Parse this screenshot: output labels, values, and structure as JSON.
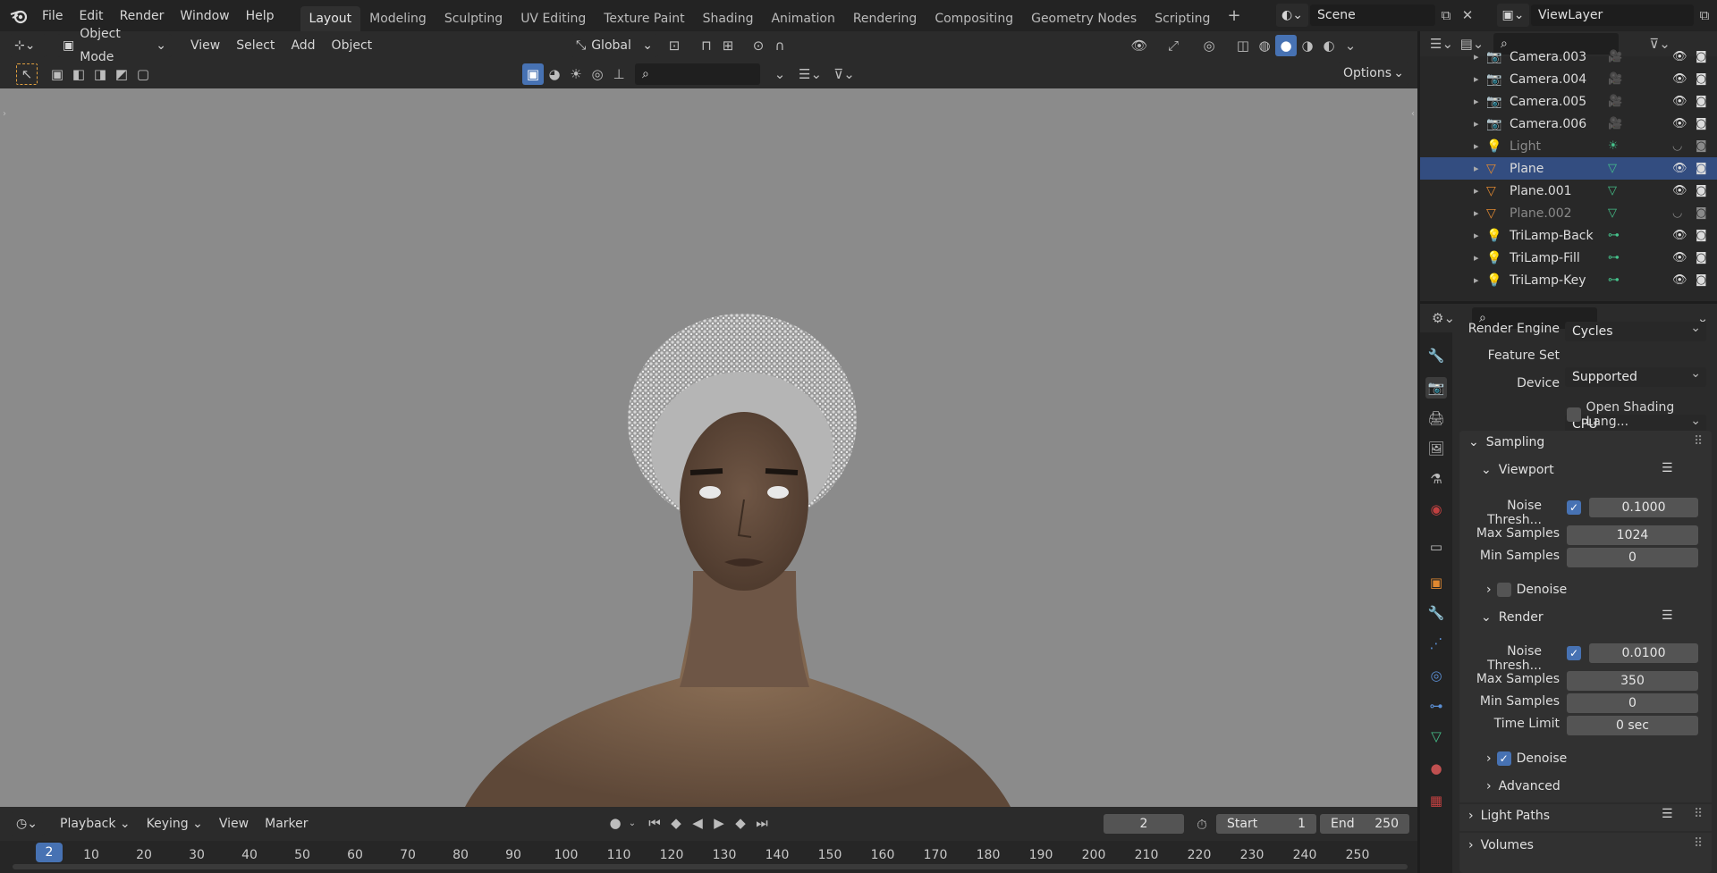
{
  "topbar": {
    "menus": [
      "File",
      "Edit",
      "Render",
      "Window",
      "Help"
    ],
    "workspaces": [
      "Layout",
      "Modeling",
      "Sculpting",
      "UV Editing",
      "Texture Paint",
      "Shading",
      "Animation",
      "Rendering",
      "Compositing",
      "Geometry Nodes",
      "Scripting"
    ],
    "active_workspace": "Layout",
    "add_tab": "+",
    "scene": "Scene",
    "view_layer": "ViewLayer"
  },
  "viewport_header": {
    "mode": "Object Mode",
    "menus": [
      "View",
      "Select",
      "Add",
      "Object"
    ],
    "orientation": "Global",
    "options": "Options"
  },
  "outliner": {
    "items": [
      {
        "name": "Camera.003",
        "state": "normal"
      },
      {
        "name": "Camera.004",
        "state": "normal"
      },
      {
        "name": "Camera.005",
        "state": "normal"
      },
      {
        "name": "Camera.006",
        "state": "normal"
      },
      {
        "name": "Light",
        "state": "dim"
      },
      {
        "name": "Plane",
        "state": "selected"
      },
      {
        "name": "Plane.001",
        "state": "normal"
      },
      {
        "name": "Plane.002",
        "state": "dim"
      },
      {
        "name": "TriLamp-Back",
        "state": "normal"
      },
      {
        "name": "TriLamp-Fill",
        "state": "normal"
      },
      {
        "name": "TriLamp-Key",
        "state": "normal"
      }
    ]
  },
  "properties": {
    "render_engine_label": "Render Engine",
    "render_engine": "Cycles",
    "feature_set_label": "Feature Set",
    "feature_set": "Supported",
    "device_label": "Device",
    "device": "CPU",
    "osl": "Open Shading Lang...",
    "sampling": "Sampling",
    "viewport": {
      "title": "Viewport",
      "noise_label": "Noise Thresh...",
      "noise": "0.1000",
      "max_label": "Max Samples",
      "max": "1024",
      "min_label": "Min Samples",
      "min": "0",
      "denoise": "Denoise"
    },
    "render": {
      "title": "Render",
      "noise_label": "Noise Thresh...",
      "noise": "0.0100",
      "max_label": "Max Samples",
      "max": "350",
      "min_label": "Min Samples",
      "min": "0",
      "time_label": "Time Limit",
      "time": "0 sec",
      "denoise": "Denoise"
    },
    "advanced": "Advanced",
    "light_paths": "Light Paths",
    "volumes": "Volumes"
  },
  "timeline": {
    "menus": [
      "Playback",
      "Keying",
      "View",
      "Marker"
    ],
    "current_frame": "2",
    "start_label": "Start",
    "start": "1",
    "end_label": "End",
    "end": "250",
    "ticks": [
      "10",
      "20",
      "30",
      "40",
      "50",
      "60",
      "70",
      "80",
      "90",
      "100",
      "110",
      "120",
      "130",
      "140",
      "150",
      "160",
      "170",
      "180",
      "190",
      "200",
      "210",
      "220",
      "230",
      "240",
      "250"
    ],
    "playhead": "2"
  },
  "colors": {
    "accent": "#4772b3",
    "selection": "#334d80",
    "viewport_bg": "#8b8b8b"
  }
}
